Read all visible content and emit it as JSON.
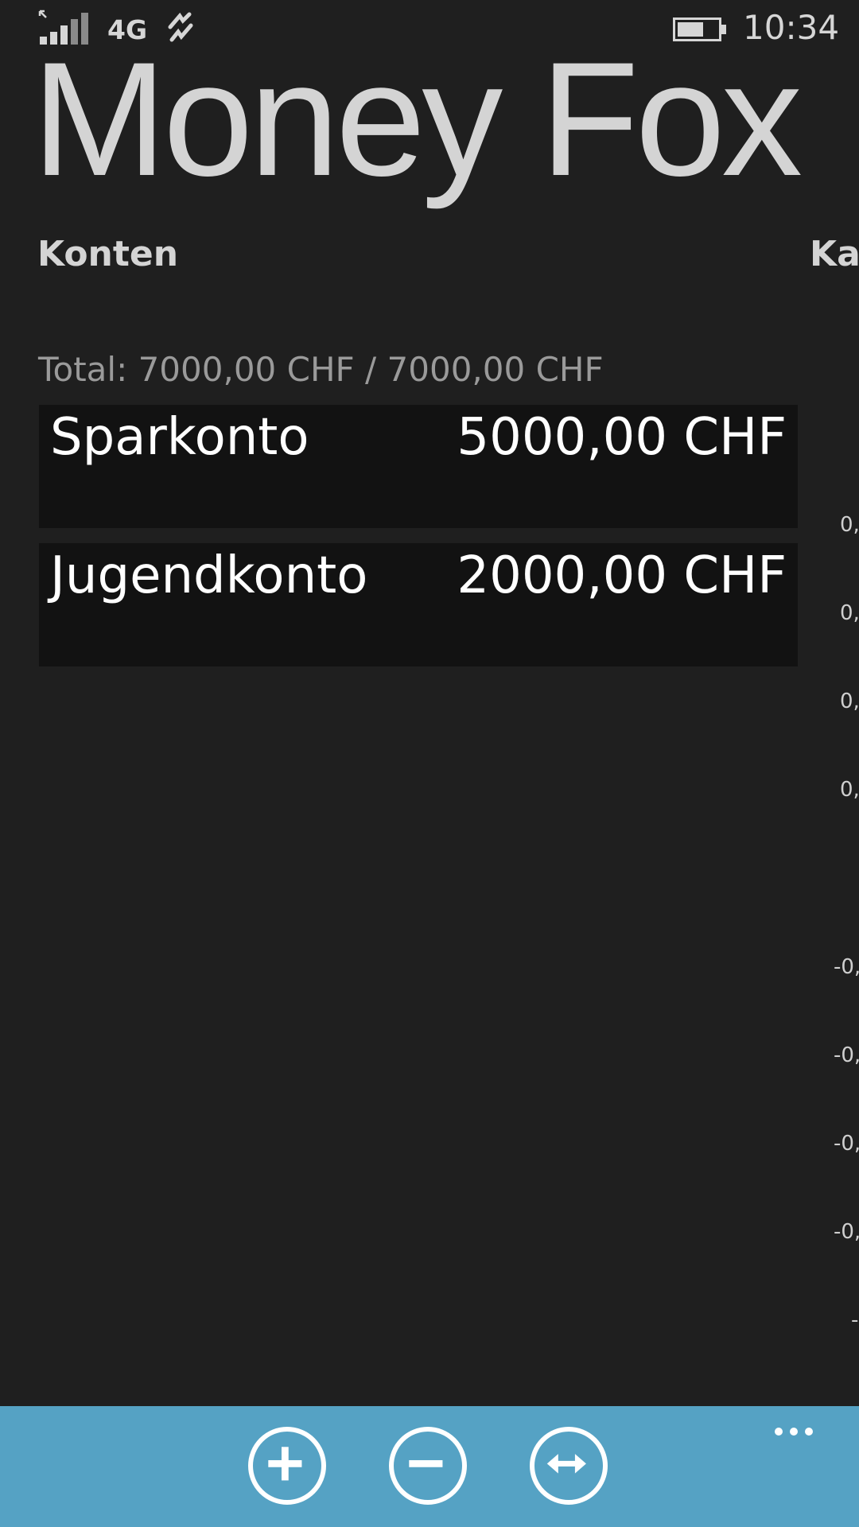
{
  "status": {
    "network": "4G",
    "time": "10:34",
    "battery_level": 0.6
  },
  "app": {
    "title": "Money Fox"
  },
  "pivot": {
    "current": "Konten",
    "next": "Kap"
  },
  "summary": {
    "total": "Total: 7000,00 CHF / 7000,00 CHF"
  },
  "accounts": [
    {
      "name": "Sparkonto",
      "amount": "5000,00 CHF"
    },
    {
      "name": "Jugendkonto",
      "amount": "2000,00 CHF"
    }
  ],
  "chart_peek": {
    "axis_labels": [
      "0,",
      "0,",
      "0,",
      "0,",
      "-0,",
      "-0,",
      "-0,",
      "-0,",
      "-"
    ]
  },
  "appbar": {
    "buttons": [
      {
        "icon": "add-icon"
      },
      {
        "icon": "remove-icon"
      },
      {
        "icon": "transfer-icon"
      }
    ],
    "more": "more-icon",
    "background": "#55a2c4"
  }
}
